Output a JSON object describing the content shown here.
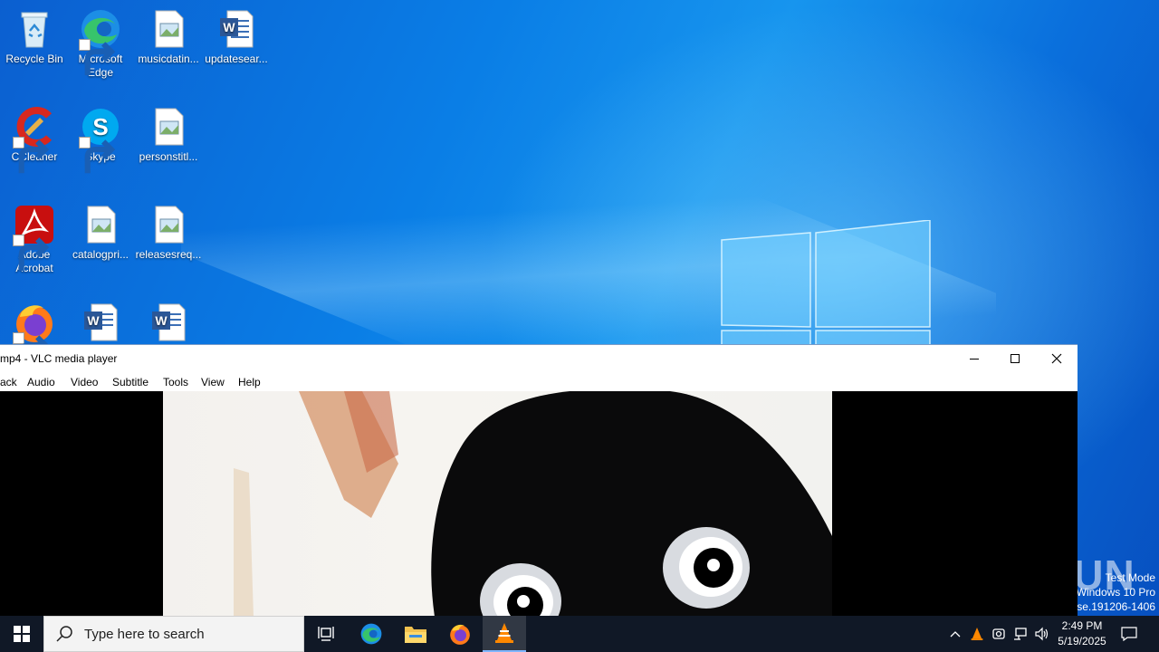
{
  "desktop": {
    "icons": [
      {
        "label": "Recycle Bin"
      },
      {
        "label": "Microsoft Edge"
      },
      {
        "label": "musicdatin..."
      },
      {
        "label": "updatesear..."
      },
      {
        "label": "CCleaner"
      },
      {
        "label": "Skype"
      },
      {
        "label": "personstitl..."
      },
      {
        "label": "Adobe Acrobat"
      },
      {
        "label": "catalogpri..."
      },
      {
        "label": "releasesreq..."
      },
      {
        "label": ""
      },
      {
        "label": ""
      },
      {
        "label": ""
      }
    ]
  },
  "vlc": {
    "title": "mp4 - VLC media player",
    "menu": [
      "ack",
      "Audio",
      "Video",
      "Subtitle",
      "Tools",
      "View",
      "Help"
    ]
  },
  "watermark": {
    "brand": "ANY RUN",
    "line1": "Test Mode",
    "line2": "Windows 10 Pro",
    "line3": "ase.191206-1406"
  },
  "taskbar": {
    "search_placeholder": "Type here to search",
    "time": "2:49 PM",
    "date": "5/19/2025"
  },
  "colors": {
    "taskbar": "#101826",
    "desktop_accent": "#0a7ee6",
    "vlc_orange": "#ff8800"
  }
}
